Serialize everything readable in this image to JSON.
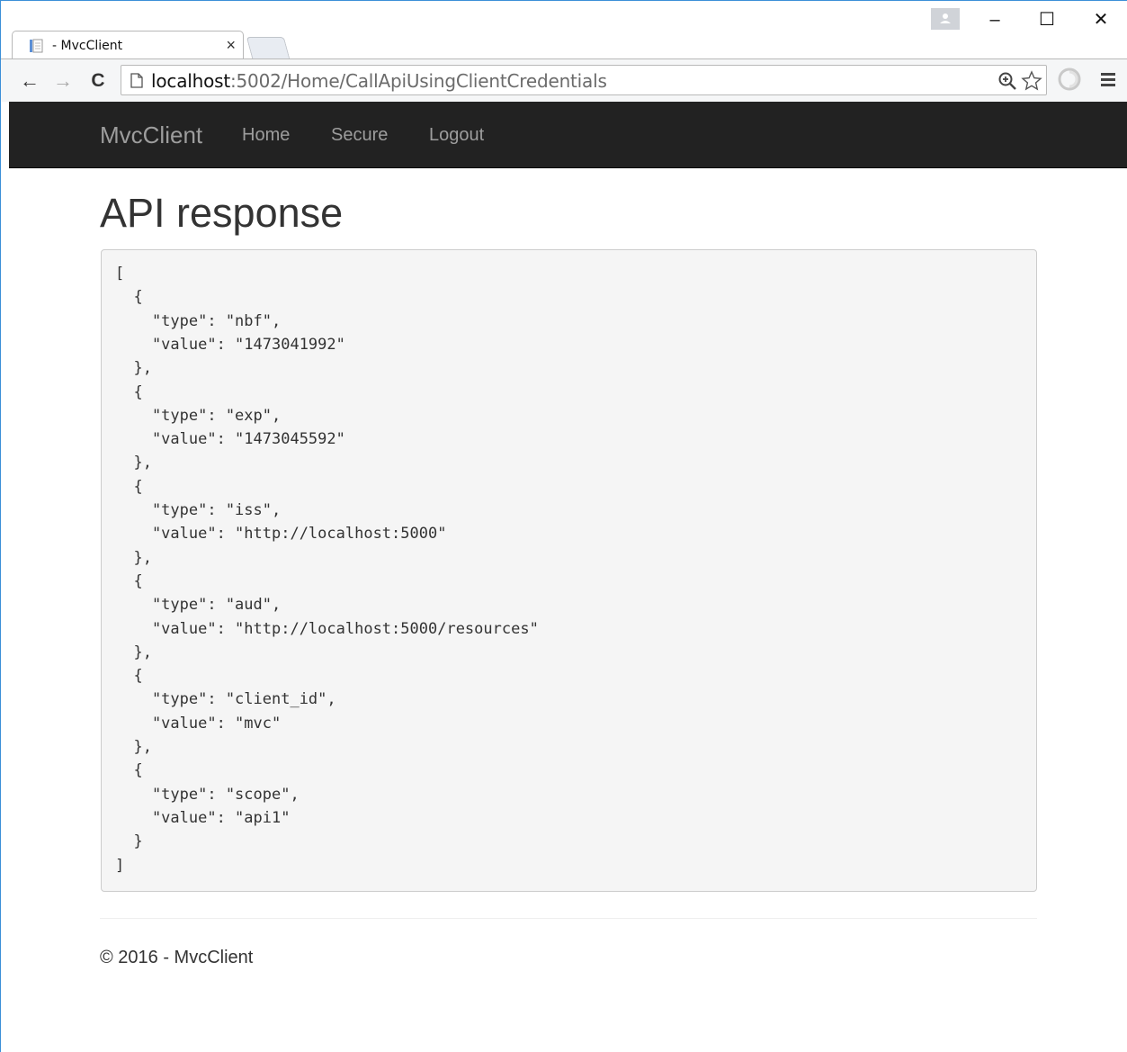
{
  "browser": {
    "tab_title": "- MvcClient",
    "tab_close": "×",
    "url_host": "localhost",
    "url_path": ":5002/Home/CallApiUsingClientCredentials",
    "window_min": "–",
    "window_max": "☐",
    "window_close": "✕",
    "back_icon": "←",
    "forward_icon": "→",
    "reload_icon": "C"
  },
  "nav": {
    "brand": "MvcClient",
    "links": [
      "Home",
      "Secure",
      "Logout"
    ]
  },
  "main": {
    "title": "API response",
    "json_lines": [
      "[",
      "  {",
      "    \"type\": \"nbf\",",
      "    \"value\": \"1473041992\"",
      "  },",
      "  {",
      "    \"type\": \"exp\",",
      "    \"value\": \"1473045592\"",
      "  },",
      "  {",
      "    \"type\": \"iss\",",
      "    \"value\": \"http://localhost:5000\"",
      "  },",
      "  {",
      "    \"type\": \"aud\",",
      "    \"value\": \"http://localhost:5000/resources\"",
      "  },",
      "  {",
      "    \"type\": \"client_id\",",
      "    \"value\": \"mvc\"",
      "  },",
      "  {",
      "    \"type\": \"scope\",",
      "    \"value\": \"api1\"",
      "  }",
      "]"
    ]
  },
  "footer": {
    "text": "© 2016 - MvcClient"
  },
  "colors": {
    "navbar": "#222222",
    "nav_text": "#9d9d9d",
    "pre_bg": "#f5f5f5"
  }
}
